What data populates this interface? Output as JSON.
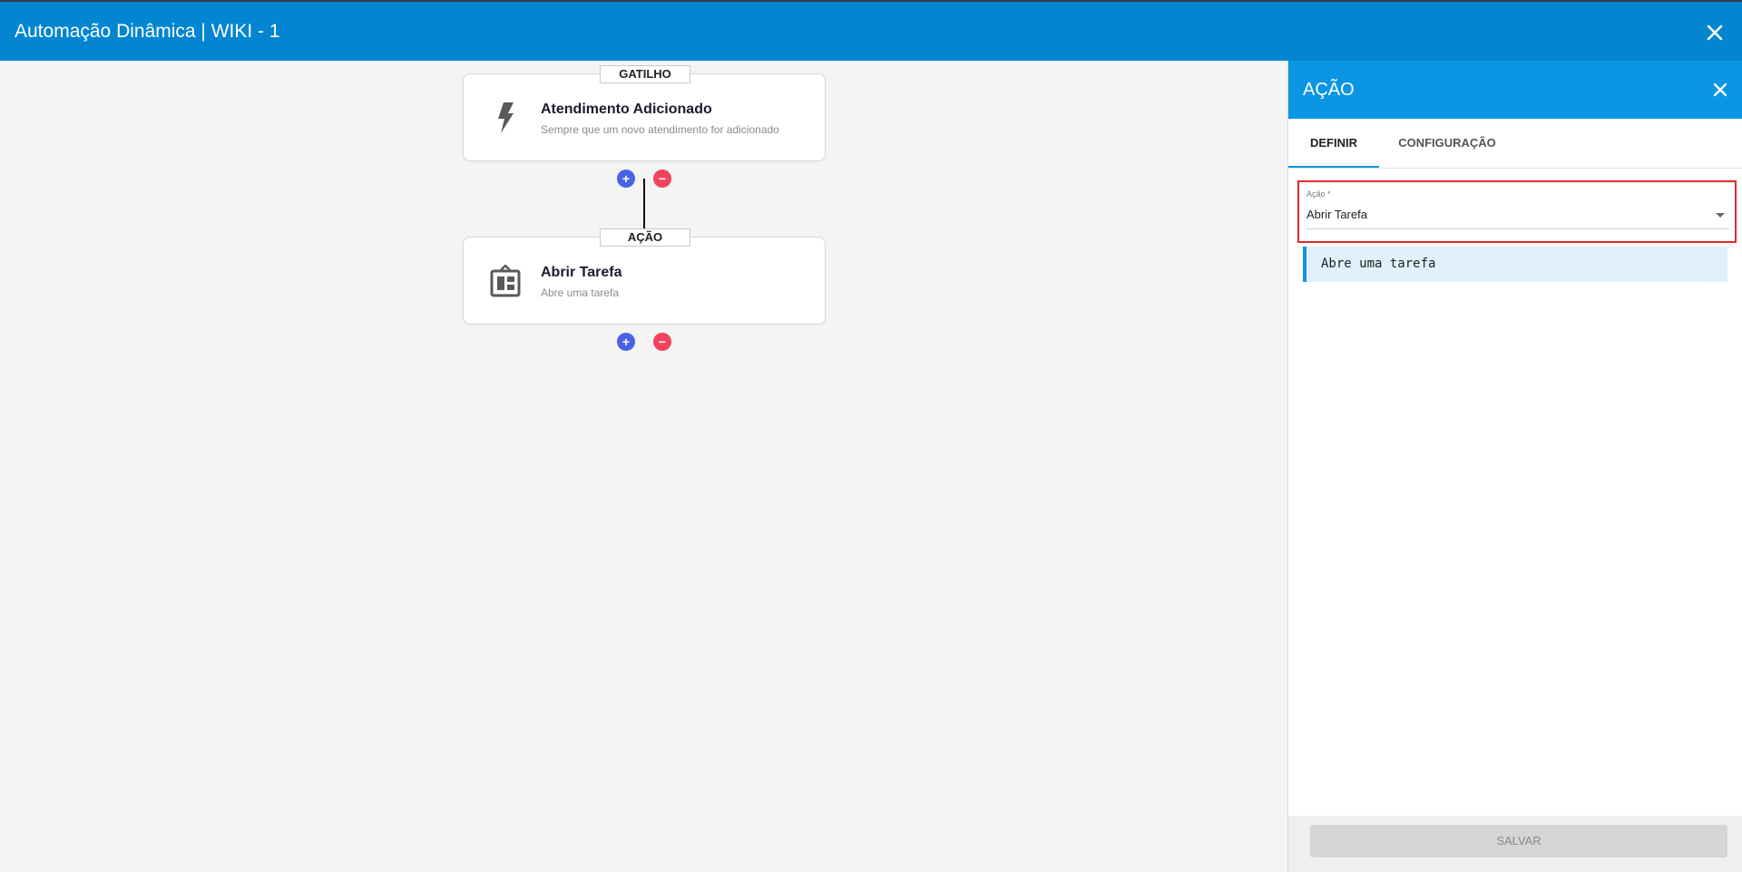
{
  "window": {
    "title": "Automação Dinâmica | WIKI - 1",
    "close_icon": "close-icon"
  },
  "flow": {
    "trigger": {
      "tag": "GATILHO",
      "title": "Atendimento Adicionado",
      "subtitle": "Sempre que um novo atendimento for adicionado",
      "icon": "lightning-bolt-icon",
      "add_label": "+",
      "remove_label": "−"
    },
    "action": {
      "tag": "AÇÃO",
      "title": "Abrir Tarefa",
      "subtitle": "Abre uma tarefa",
      "icon": "task-board-icon",
      "add_label": "+",
      "remove_label": "−"
    }
  },
  "panel": {
    "title": "AÇÃO",
    "tabs": [
      {
        "label": "DEFINIR",
        "active": true
      },
      {
        "label": "CONFIGURAÇÃO",
        "active": false
      }
    ],
    "field": {
      "label": "Ação *",
      "value": "Abrir Tarefa"
    },
    "info": "Abre uma tarefa",
    "save_label": "SALVAR"
  },
  "colors": {
    "topbar": "#0385d1",
    "panel_header": "#0a96e4",
    "add_button": "#4a63e6",
    "remove_button": "#f0445e",
    "highlight_border": "#e32a2a"
  }
}
